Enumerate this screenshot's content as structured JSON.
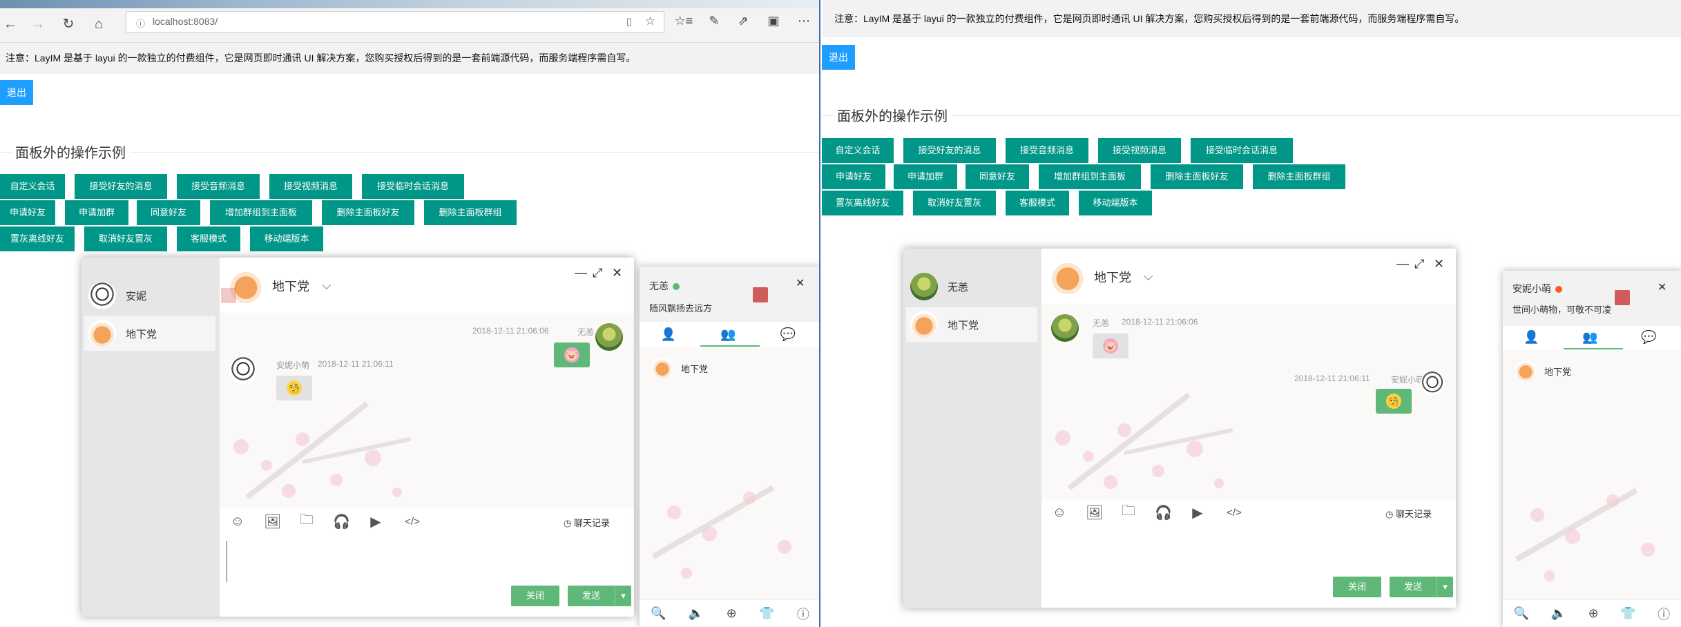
{
  "browser": {
    "url": "localhost:8083/",
    "back_icon": "←",
    "forward_icon": "→",
    "refresh_icon": "↻",
    "home_icon": "⌂",
    "info_icon": "ⓘ",
    "reader_icon": "▯",
    "fav_icon": "☆",
    "favbar_icon": "☆≡",
    "pen_icon": "✎",
    "share_icon": "⇗",
    "store_icon": "▣",
    "more_icon": "⋯"
  },
  "left": {
    "notice": "注意：LayIM 是基于 layui 的一款独立的付费组件，它是网页即时通讯 UI 解决方案，您购买授权后得到的是一套前端源代码，而服务端程序需自写。",
    "logout": "退出",
    "legend": "面板外的操作示例",
    "buttons_row1": [
      "自定义会话",
      "接受好友的消息",
      "接受音频消息",
      "接受视频消息",
      "接受临时会话消息"
    ],
    "buttons_row2": [
      "申请好友",
      "申请加群",
      "同意好友",
      "增加群组到主面板",
      "删除主面板好友",
      "删除主面板群组"
    ],
    "buttons_row3": [
      "置灰离线好友",
      "取消好友置灰",
      "客服模式",
      "移动端版本"
    ],
    "chat": {
      "list": [
        "安妮",
        "地下党"
      ],
      "title": "地下党",
      "down_icon": "⌵",
      "min_icon": "—",
      "max_icon": "⤢",
      "close_icon": "✕",
      "msg1": {
        "time": "2018-12-11 21:06:06",
        "name": "无恙",
        "emoji": "🐷"
      },
      "msg2": {
        "name": "安妮小萌",
        "time": "2018-12-11 21:06:11",
        "emoji": "🧐"
      },
      "tools": [
        "☺",
        "🖼",
        "🗀",
        "🎧",
        "▶",
        "</>"
      ],
      "history_icon": "◷",
      "history": "聊天记录",
      "close_btn": "关闭",
      "send_btn": "发送",
      "send_arrow": "▾"
    },
    "main_panel": {
      "name": "无恙",
      "status_color": "#5fb878",
      "sign": "随风飘扬去远方",
      "close_icon": "✕",
      "tabs": [
        "👤",
        "👥",
        "💬"
      ],
      "friend": "地下党",
      "foot": [
        "🔍",
        "🔈",
        "⊕",
        "👕",
        "ⓘ"
      ]
    }
  },
  "right": {
    "notice": "注意：LayIM 是基于 layui 的一款独立的付费组件，它是网页即时通讯 UI 解决方案，您购买授权后得到的是一套前端源代码，而服务端程序需自写。",
    "logout": "退出",
    "legend": "面板外的操作示例",
    "buttons_row1": [
      "自定义会话",
      "接受好友的消息",
      "接受音频消息",
      "接受视频消息",
      "接受临时会话消息"
    ],
    "buttons_row2": [
      "申请好友",
      "申请加群",
      "同意好友",
      "增加群组到主面板",
      "删除主面板好友",
      "删除主面板群组"
    ],
    "buttons_row3": [
      "置灰离线好友",
      "取消好友置灰",
      "客服模式",
      "移动端版本"
    ],
    "chat": {
      "list": [
        "无恙",
        "地下党"
      ],
      "title": "地下党",
      "msg1": {
        "name": "无恙",
        "time": "2018-12-11 21:06:06",
        "emoji": "🐷"
      },
      "msg2": {
        "time": "2018-12-11 21:06:11",
        "name": "安妮小萌",
        "emoji": "🧐"
      },
      "history": "聊天记录",
      "close_btn": "关闭",
      "send_btn": "发送"
    },
    "main_panel": {
      "name": "安妮小萌",
      "status_color": "#ff5722",
      "sign": "世间小萌物，可敬不可凌",
      "friend": "地下党"
    }
  }
}
